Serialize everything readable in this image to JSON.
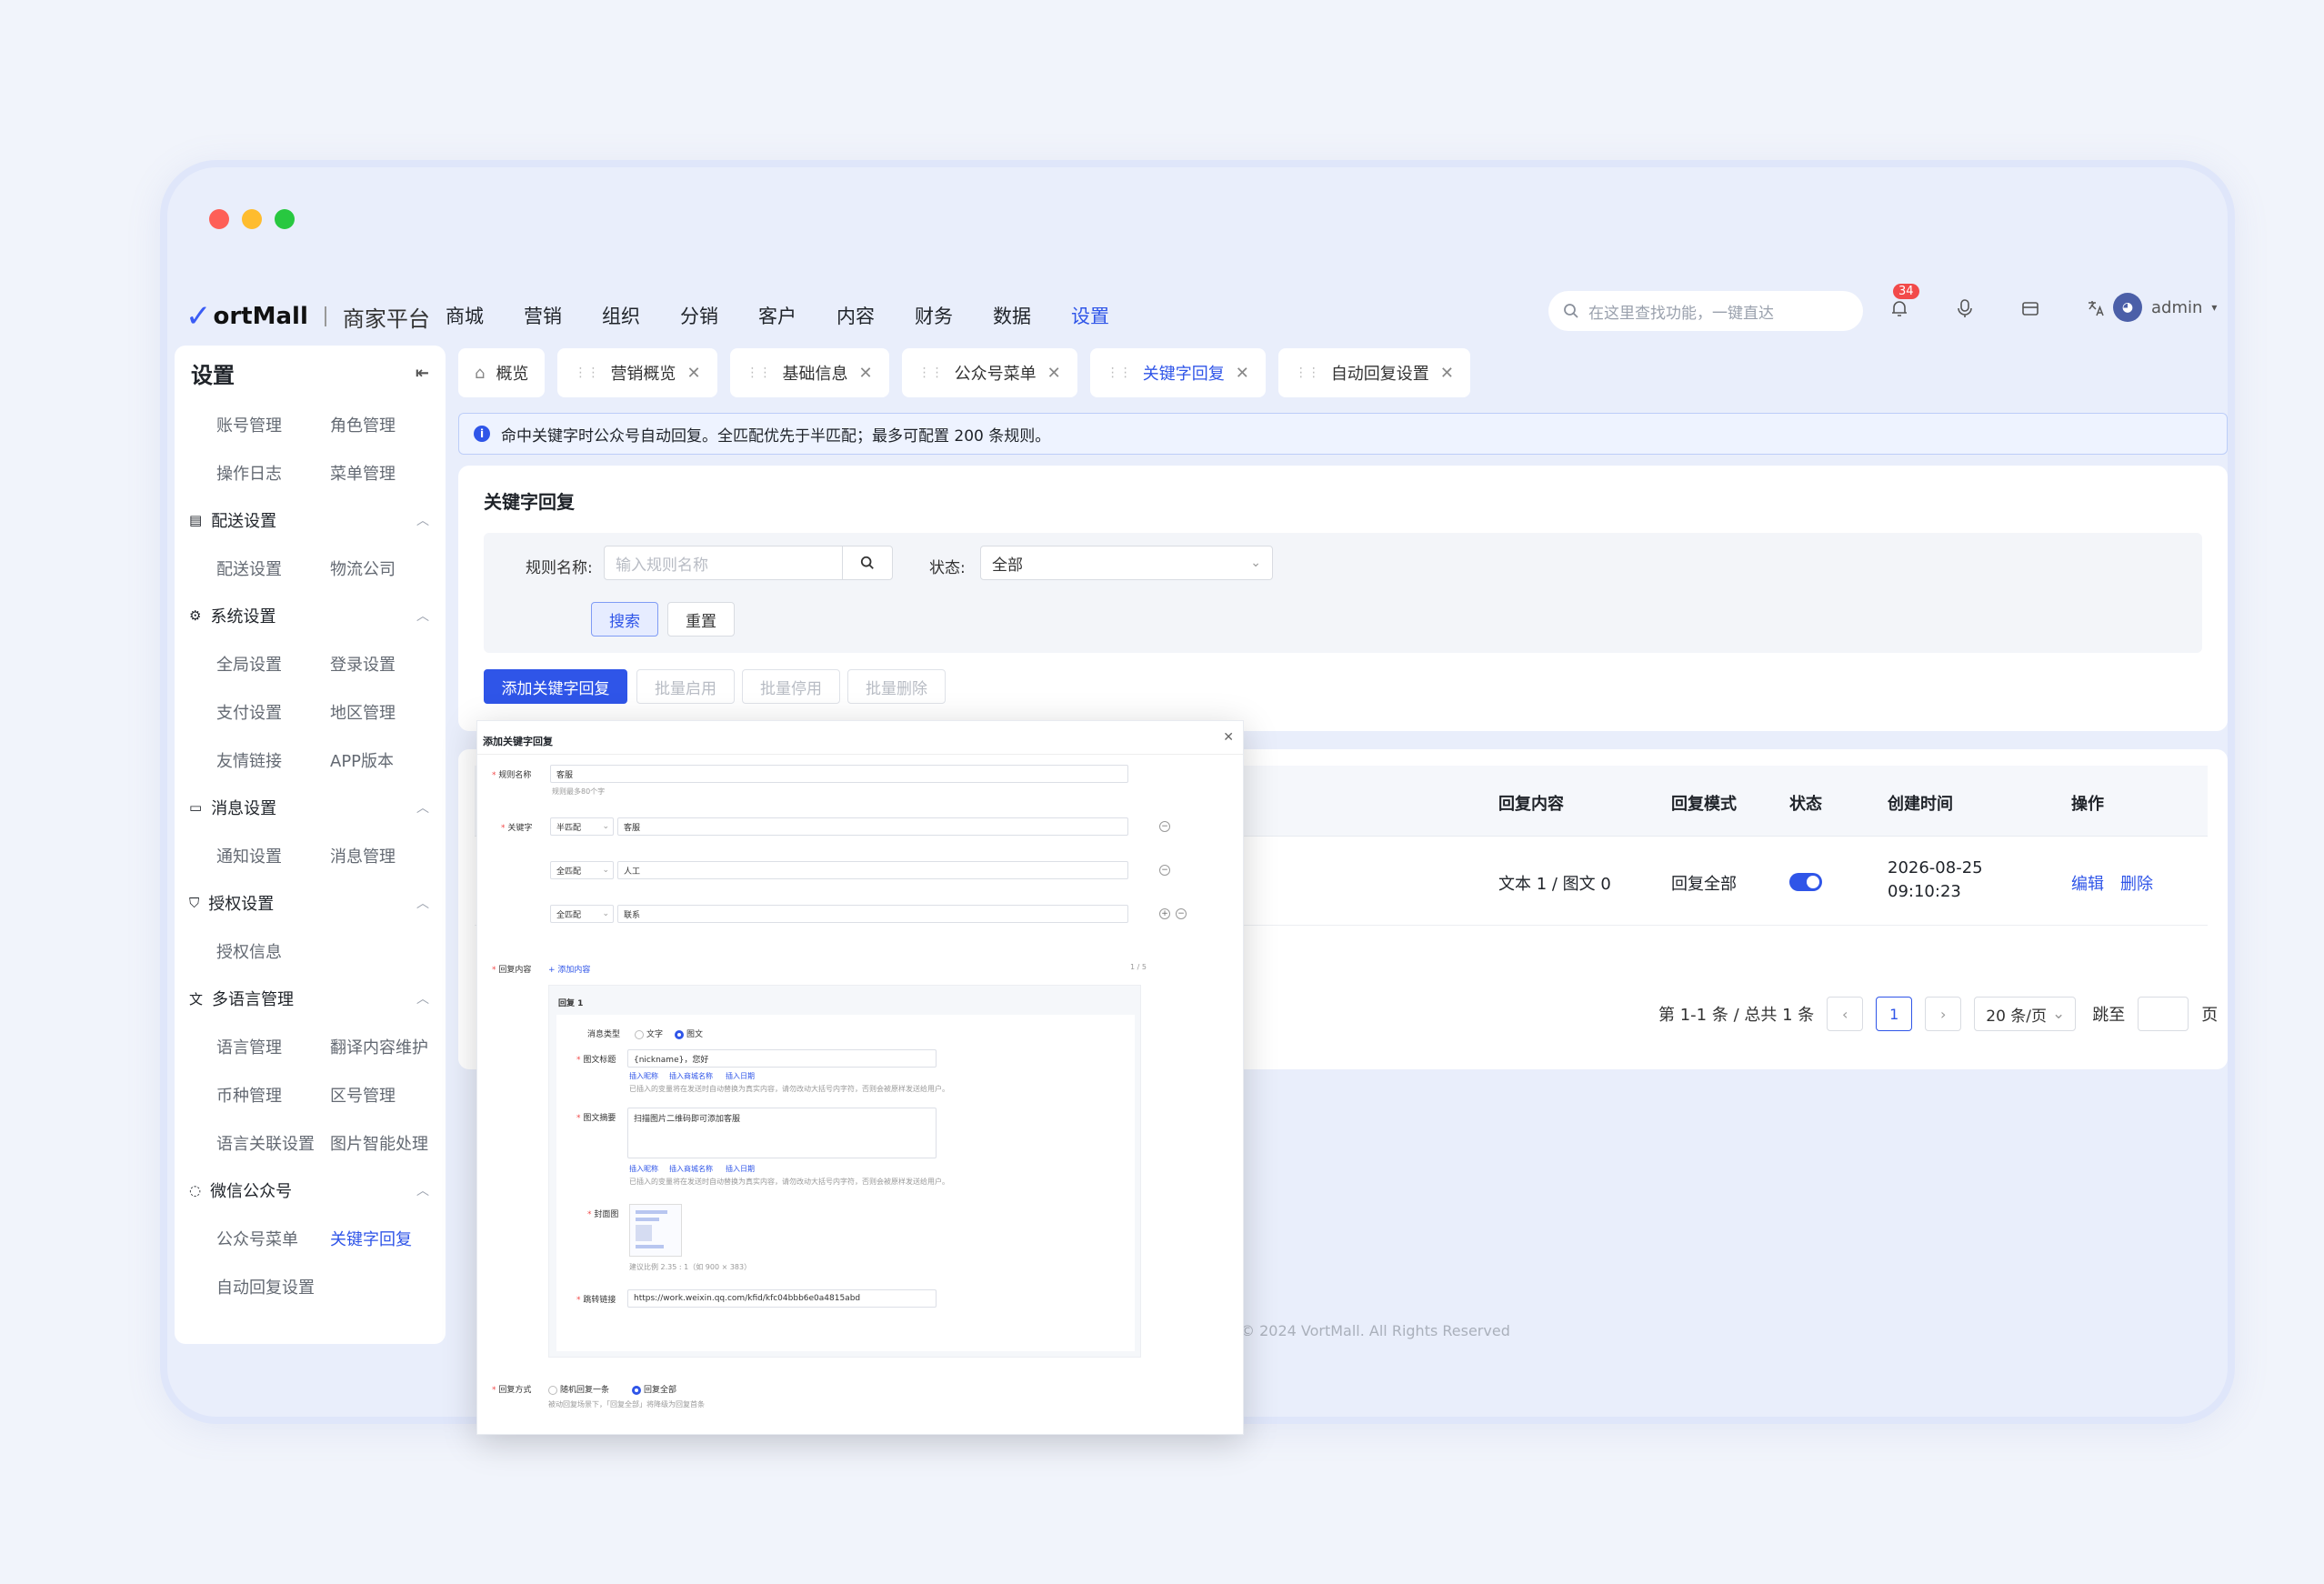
{
  "window": {
    "dots": [
      "close",
      "minimize",
      "maximize"
    ]
  },
  "brand": {
    "logo": "ortMall",
    "sub": "商家平台"
  },
  "nav": {
    "items": [
      "商城",
      "营销",
      "组织",
      "分销",
      "客户",
      "内容",
      "财务",
      "数据",
      "设置"
    ],
    "active": "设置"
  },
  "search": {
    "placeholder": "在这里查找功能，一键直达"
  },
  "header_icons": {
    "bell_badge": "34",
    "icons": [
      "bell-icon",
      "microphone-icon",
      "store-icon",
      "translate-icon"
    ]
  },
  "user": {
    "name": "admin"
  },
  "sidebar": {
    "title": "设置",
    "groups": [
      {
        "title": "",
        "items": [
          "账号管理",
          "角色管理",
          "操作日志",
          "菜单管理"
        ]
      },
      {
        "title": "配送设置",
        "items": [
          "配送设置",
          "物流公司"
        ]
      },
      {
        "title": "系统设置",
        "items": [
          "全局设置",
          "登录设置",
          "支付设置",
          "地区管理",
          "友情链接",
          "APP版本"
        ]
      },
      {
        "title": "消息设置",
        "items": [
          "通知设置",
          "消息管理"
        ]
      },
      {
        "title": "授权设置",
        "items": [
          "授权信息"
        ]
      },
      {
        "title": "多语言管理",
        "items": [
          "语言管理",
          "翻译内容维护",
          "币种管理",
          "区号管理",
          "语言关联设置",
          "图片智能处理"
        ]
      },
      {
        "title": "微信公众号",
        "items": [
          "公众号菜单",
          "关键字回复",
          "自动回复设置"
        ]
      }
    ],
    "active": "关键字回复"
  },
  "tabs": [
    {
      "label": "概览",
      "closable": false
    },
    {
      "label": "营销概览",
      "closable": true
    },
    {
      "label": "基础信息",
      "closable": true
    },
    {
      "label": "公众号菜单",
      "closable": true
    },
    {
      "label": "关键字回复",
      "closable": true,
      "active": true
    },
    {
      "label": "自动回复设置",
      "closable": true
    }
  ],
  "alert": {
    "text": "命中关键字时公众号自动回复。全匹配优先于半匹配；最多可配置 200 条规则。"
  },
  "panel": {
    "title": "关键字回复",
    "rule_label": "规则名称:",
    "rule_placeholder": "输入规则名称",
    "status_label": "状态:",
    "status_value": "全部",
    "search_btn": "搜索",
    "reset_btn": "重置",
    "add_btn": "添加关键字回复",
    "batch_enable": "批量启用",
    "batch_disable": "批量停用",
    "batch_delete": "批量删除"
  },
  "table": {
    "headers": [
      "回复内容",
      "回复模式",
      "状态",
      "创建时间",
      "操作"
    ],
    "rows": [
      {
        "content": "文本 1 / 图文 0",
        "mode": "回复全部",
        "enabled": true,
        "date": "2026-08-25",
        "time": "09:10:23",
        "edit": "编辑",
        "delete": "删除"
      }
    ]
  },
  "pagination": {
    "summary": "第 1-1 条 / 总共 1 条",
    "current": "1",
    "page_size": "20 条/页",
    "jump_label": "跳至",
    "page_unit": "页"
  },
  "footer": {
    "text": "© 2024 VortMall. All Rights Reserved"
  },
  "dialog": {
    "title": "添加关键字回复",
    "rule_name_label": "规则名称",
    "rule_name_value": "客服",
    "rule_name_hint": "规则最多80个字",
    "keyword_label": "关键字",
    "keywords": [
      {
        "match": "半匹配",
        "value": "客服"
      },
      {
        "match": "全匹配",
        "value": "人工"
      },
      {
        "match": "全匹配",
        "value": "联系"
      }
    ],
    "reply_content_label": "回复内容",
    "add_content": "+ 添加内容",
    "content_count": "1 / 5",
    "reply_title": "回复 1",
    "msg_type_label": "消息类型",
    "msg_type_options": [
      "文字",
      "图文"
    ],
    "msg_type_selected": "图文",
    "article_title_label": "图文标题",
    "article_title_value": "{nickname}，您好",
    "insert_links": [
      "插入昵称",
      "插入商城名称",
      "插入日期"
    ],
    "insert_hint": "已插入的变量将在发送时自动替换为真实内容，请勿改动大括号内字符，否则会被原样发送给用户。",
    "summary_label": "图文摘要",
    "summary_value": "扫描图片二维码即可添加客服",
    "cover_label": "封面图",
    "cover_hint": "建议比例 2.35 : 1（如 900 × 383）",
    "link_label": "跳转链接",
    "link_value": "https://work.weixin.qq.com/kfid/kfc04bbb6e0a4815abd",
    "reply_mode_label": "回复方式",
    "reply_mode_options": [
      "随机回复一条",
      "回复全部"
    ],
    "reply_mode_selected": "回复全部",
    "reply_mode_hint": "被动回复场景下，「回复全部」将降级为回复首条"
  },
  "colors": {
    "accent": "#2f55e8",
    "danger": "#f24a4a"
  }
}
